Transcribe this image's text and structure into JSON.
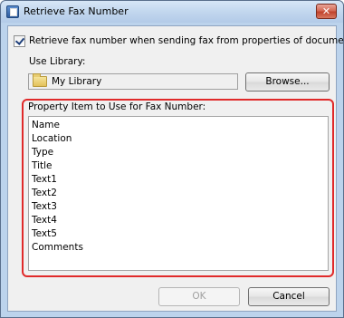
{
  "window": {
    "title": "Retrieve Fax Number",
    "close_label": "✕"
  },
  "options": {
    "retrieve_checkbox_label": "Retrieve fax number when sending fax from properties of document",
    "retrieve_checked": true
  },
  "library": {
    "label": "Use Library:",
    "value": "My Library",
    "browse_label": "Browse..."
  },
  "property": {
    "label": "Property Item to Use for Fax Number:",
    "items": [
      "Name",
      "Location",
      "Type",
      "Title",
      "Text1",
      "Text2",
      "Text3",
      "Text4",
      "Text5",
      "Comments"
    ]
  },
  "buttons": {
    "ok_label": "OK",
    "cancel_label": "Cancel"
  },
  "colors": {
    "highlight": "#e02a2a",
    "close_button": "#c0432c"
  }
}
